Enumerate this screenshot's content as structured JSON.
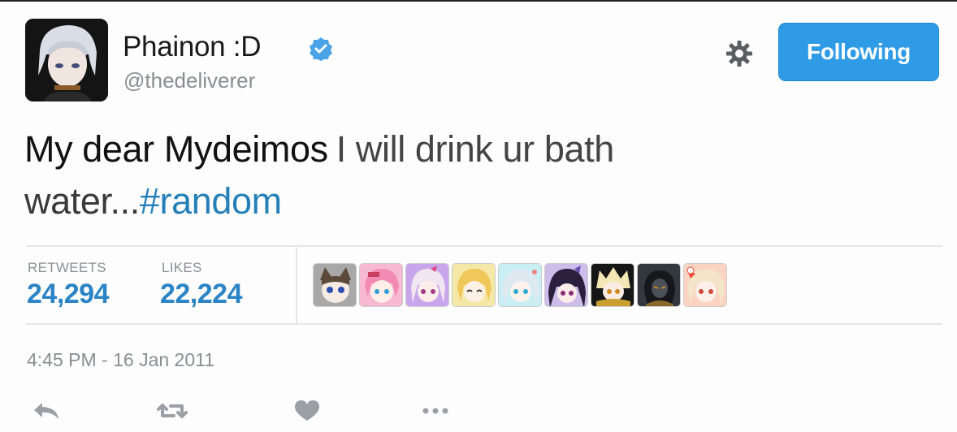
{
  "user": {
    "display_name": "Phainon :D",
    "handle": "@thedeliverer",
    "verified": true,
    "avatar_icon": "avatar"
  },
  "header": {
    "follow_label": "Following",
    "settings_icon": "gear-icon"
  },
  "tweet": {
    "text_part1": "My dear Mydeimos",
    "text_part2": "I will drink ur bath",
    "text_part3": "water...",
    "hashtag": "#random"
  },
  "stats": {
    "retweets_label": "RETWEETS",
    "retweets_value": "24,294",
    "likes_label": "LIKES",
    "likes_value": "22,224"
  },
  "likers": [
    {
      "name": "liker-avatar-1",
      "bg": "#9a9a9a"
    },
    {
      "name": "liker-avatar-2",
      "bg": "#f4a7c4"
    },
    {
      "name": "liker-avatar-3",
      "bg": "#c6a3e8"
    },
    {
      "name": "liker-avatar-4",
      "bg": "#f3e39a"
    },
    {
      "name": "liker-avatar-5",
      "bg": "#bfeaf0"
    },
    {
      "name": "liker-avatar-6",
      "bg": "#c7b8e8"
    },
    {
      "name": "liker-avatar-7",
      "bg": "#1b1b1b"
    },
    {
      "name": "liker-avatar-8",
      "bg": "#3a3f47"
    },
    {
      "name": "liker-avatar-9",
      "bg": "#f7c8b4"
    }
  ],
  "timestamp": "4:45 PM - 16 Jan 2011",
  "actions": [
    "reply-icon",
    "retweet-icon",
    "like-icon",
    "more-icon"
  ],
  "colors": {
    "accent": "#2f9be7",
    "link": "#2680b8",
    "muted": "#8a8d91"
  }
}
